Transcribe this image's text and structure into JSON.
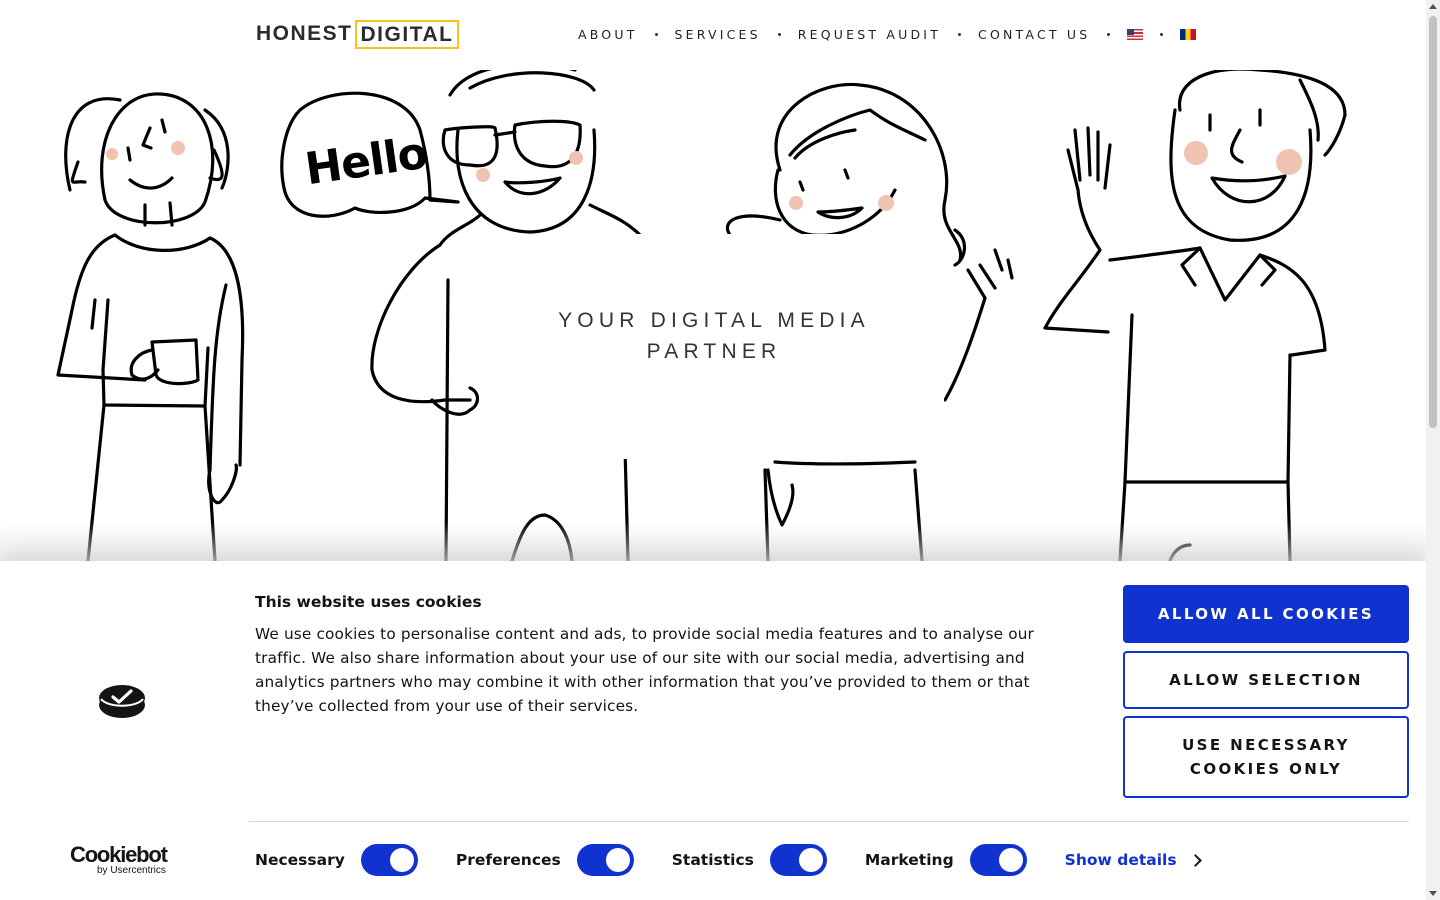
{
  "header": {
    "logo_part1": "HONEST",
    "logo_part2": "DIGITAL",
    "nav": [
      {
        "label": "ABOUT"
      },
      {
        "label": "SERVICES"
      },
      {
        "label": "REQUEST AUDIT"
      },
      {
        "label": "CONTACT US"
      }
    ],
    "languages": [
      {
        "icon": "us-flag-icon"
      },
      {
        "icon": "romania-flag-icon"
      }
    ]
  },
  "hero": {
    "title": "YOUR DIGITAL MEDIA PARTNER",
    "speech_bubble": "Hello",
    "illustration": "four-line-drawn-people-illustration"
  },
  "cookie_banner": {
    "title": "This website uses cookies",
    "text": "We use cookies to personalise content and ads, to provide social media features and to analyse our traffic. We also share information about your use of our site with our social media, advertising and analytics partners who may combine it with other information that you’ve provided to them or that they’ve collected from your use of their services.",
    "buttons": {
      "allow_all": "ALLOW ALL COOKIES",
      "allow_selection": "ALLOW SELECTION",
      "necessary_only": "USE NECESSARY COOKIES ONLY"
    },
    "toggles": [
      {
        "label": "Necessary",
        "on": true
      },
      {
        "label": "Preferences",
        "on": true
      },
      {
        "label": "Statistics",
        "on": true
      },
      {
        "label": "Marketing",
        "on": true
      }
    ],
    "show_details": "Show details",
    "brand": {
      "name": "Cookiebot",
      "sub": "by Usercentrics"
    },
    "accent_color": "#1032cf"
  },
  "brand_colors": {
    "logo_border": "#f3c51b",
    "blush": "#f1c3b2"
  }
}
